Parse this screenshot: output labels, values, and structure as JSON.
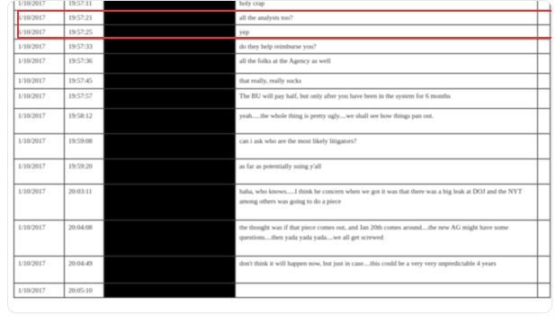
{
  "rows": [
    {
      "date": "1/10/2017",
      "time": "19:57:11",
      "message": "holy crap"
    },
    {
      "date": "1/10/2017",
      "time": "19:57:21",
      "message": "all the analysts too?"
    },
    {
      "date": "1/10/2017",
      "time": "19:57:25",
      "message": "yep"
    },
    {
      "date": "1/10/2017",
      "time": "19:57:33",
      "message": "do they help reimburse you?"
    },
    {
      "date": "1/10/2017",
      "time": "19:57:36",
      "message": "all the folks at the Agency as well"
    },
    {
      "date": "1/10/2017",
      "time": "19:57:45",
      "message": "that really, really sucks"
    },
    {
      "date": "1/10/2017",
      "time": "19:57:57",
      "message": "The BU will pay half, but only after you have been in the system for 6 months"
    },
    {
      "date": "1/10/2017",
      "time": "19:58:12",
      "message": "yeah.....the whole thing is pretty ugly....we shall see how things pan out."
    },
    {
      "date": "1/10/2017",
      "time": "19:59:08",
      "message": "can i ask who are the most likely litigators?"
    },
    {
      "date": "1/10/2017",
      "time": "19:59:20",
      "message": "as far as potentially suing y'all"
    },
    {
      "date": "1/10/2017",
      "time": "20:03:11",
      "message": "haha, who knows.....I think he concern when we got it was that there was a big leak at DOJ and the NYT among others was going to do a piece"
    },
    {
      "date": "1/10/2017",
      "time": "20:04:08",
      "message": "the thought was if that piece comes out, and Jan 20th comes around....the new AG might have some questions....then yada yada yada....we all get screwed"
    },
    {
      "date": "1/10/2017",
      "time": "20:04:49",
      "message": "don't think it will happen now, but just in case....this could be a very very unpredictable 4 years"
    },
    {
      "date": "1/10/2017",
      "time": "20:05:10",
      "message": ""
    }
  ]
}
